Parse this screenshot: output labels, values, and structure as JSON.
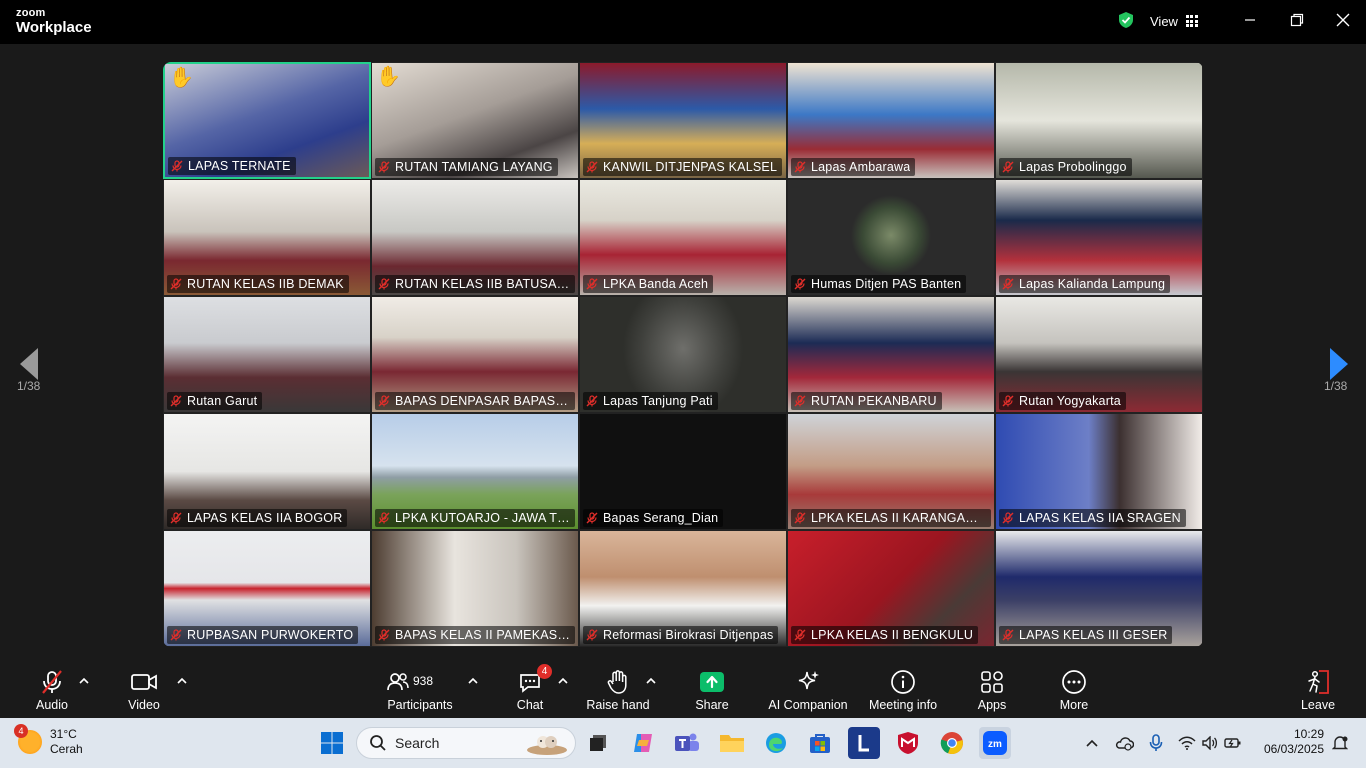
{
  "app": {
    "brand_top": "zoom",
    "brand_bottom": "Workplace",
    "view_label": "View"
  },
  "navigation": {
    "page_left": "1/38",
    "page_right": "1/38"
  },
  "tiles": [
    {
      "name": "LAPAS TERNATE",
      "hand": "✋",
      "bg": "linear-gradient(160deg,#c9ccd8 0%,#5565a6 45%,#2d3e8c 70%,#6b5a58 100%)"
    },
    {
      "name": "RUTAN TAMIANG LAYANG",
      "hand": "✋",
      "bg": "linear-gradient(160deg,#e3dcd3 0%,#a59d97 45%,#4b4545 75%,#c9c4bf 100%)"
    },
    {
      "name": "KANWIL DITJENPAS KALSEL",
      "hand": "",
      "bg": "linear-gradient(180deg,#8b1a2b 0%,#2c5aa8 40%,#d6ae57 70%,#7a6545 100%)"
    },
    {
      "name": "Lapas Ambarawa",
      "hand": "",
      "bg": "linear-gradient(180deg,#efe3d2 0%,#3c78c6 45%,#9a2c35 75%,#c7c2bd 100%)"
    },
    {
      "name": "Lapas Probolinggo",
      "hand": "",
      "bg": "linear-gradient(180deg,#b5b8aa 0%,#e5e5dc 50%,#8e8f86 80%,#55584f 100%)"
    },
    {
      "name": "RUTAN KELAS IIB DEMAK",
      "hand": "",
      "bg": "linear-gradient(180deg,#f2efe9 0%,#c9c3bb 45%,#7a2830 70%,#8a5a36 100%)"
    },
    {
      "name": "RUTAN KELAS IIB BATUSANGK...",
      "hand": "",
      "bg": "linear-gradient(180deg,#ecebe8 0%,#c8c8c4 45%,#6b2830 75%,#4d4a48 100%)"
    },
    {
      "name": "LPKA Banda Aceh",
      "hand": "",
      "bg": "linear-gradient(180deg,#eae9e1 0%,#d7d2c8 35%,#a82434 65%,#b8b2ab 100%)"
    },
    {
      "name": "Humas Ditjen PAS Banten",
      "hand": "",
      "bg": "radial-gradient(ellipse 40px 40px at 50% 48%,#7b8a68 0%,#3a4a35 70%,#2b2b2b 100%)"
    },
    {
      "name": "Lapas Kalianda Lampung",
      "hand": "",
      "bg": "linear-gradient(180deg,#e0ddd8 0%,#1a2a4a 35%,#b3313c 70%,#c6c9cf 100%)"
    },
    {
      "name": "Rutan Garut",
      "hand": "",
      "bg": "linear-gradient(180deg,#dddfe2 0%,#c9cbcf 40%,#5b2e33 70%,#3a3838 100%)"
    },
    {
      "name": "BAPAS DENPASAR BAPAS DEN...",
      "hand": "",
      "bg": "linear-gradient(180deg,#f0ece6 0%,#d8d2c8 35%,#7a2833 65%,#b39e86 100%)"
    },
    {
      "name": "Lapas Tanjung Pati",
      "hand": "",
      "bg": "radial-gradient(ellipse 60px 70px at 50% 45%,#6f6f6b 0%,#3f403c 70%,#2e2f2b 100%)"
    },
    {
      "name": "RUTAN PEKANBARU",
      "hand": "",
      "bg": "linear-gradient(180deg,#dcd8d0 0%,#1c2b55 40%,#a3283a 70%,#c7c0b7 100%)"
    },
    {
      "name": "Rutan Yogyakarta",
      "hand": "",
      "bg": "linear-gradient(180deg,#e9e8e4 0%,#c5c3be 40%,#3a3535 65%,#8d2a34 100%)"
    },
    {
      "name": "LAPAS KELAS IIA BOGOR",
      "hand": "",
      "bg": "linear-gradient(180deg,#f4f4f3 0%,#e6e6e4 50%,#5b4a44 75%,#2f2a28 100%)"
    },
    {
      "name": "LPKA KUTOARJO - JAWA TEN...",
      "hand": "",
      "bg": "linear-gradient(180deg,#b7cde8 0%,#d6e2ee 45%,#8f9ea5 55%,#7aa35a 70%,#5b8e2e 100%)"
    },
    {
      "name": "Bapas Serang_Dian",
      "hand": "",
      "bg": "#101010"
    },
    {
      "name": "LPKA KELAS II KARANGASEM",
      "hand": "",
      "bg": "linear-gradient(180deg,#cfd3d8 0%,#c39d86 45%,#a83a3a 70%,#9a7e72 100%)"
    },
    {
      "name": "LAPAS KELAS IIA SRAGEN",
      "hand": "",
      "bg": "linear-gradient(90deg,#2f4bb2 0%,#6d7fc7 45%,#3c3030 60%,#f1ece8 100%)"
    },
    {
      "name": "RUPBASAN PURWOKERTO",
      "hand": "",
      "bg": "linear-gradient(180deg,#ecedef 0%,#e5e6e9 45%,#c8222c 50%,#e0e1e3 60%,#5b6c9a 100%)"
    },
    {
      "name": "BAPAS KELAS II PAMEKASAN",
      "hand": "",
      "bg": "linear-gradient(90deg,#4d3d31 0%,#e8e4de 40%,#c9c4bd 70%,#6b5a4d 100%)"
    },
    {
      "name": "Reformasi Birokrasi Ditjenpas",
      "hand": "",
      "bg": "linear-gradient(180deg,#d9b59a 0%,#bf8f6f 40%,#f2f2f0 65%,#2b2b2b 100%)"
    },
    {
      "name": "LPKA KELAS II BENGKULU",
      "hand": "",
      "bg": "linear-gradient(135deg,#c81f2b 0%,#9b1520 50%,#4a3a36 75%,#7a2630 100%)"
    },
    {
      "name": "LAPAS KELAS III GESER",
      "hand": "",
      "bg": "linear-gradient(180deg,#e9eaec 0%,#1f2a6b 40%,#3b3f66 60%,#a9a29c 100%)"
    }
  ],
  "toolbar": {
    "audio": "Audio",
    "video": "Video",
    "participants": "Participants",
    "participants_count": "938",
    "chat": "Chat",
    "chat_badge": "4",
    "raise_hand": "Raise hand",
    "share": "Share",
    "ai_companion": "AI Companion",
    "meeting_info": "Meeting info",
    "apps": "Apps",
    "more": "More",
    "leave": "Leave"
  },
  "taskbar": {
    "weather_badge": "4",
    "temperature": "31°C",
    "condition": "Cerah",
    "search_placeholder": "Search",
    "time": "10:29",
    "date": "06/03/2025"
  },
  "colors": {
    "active_speaker": "#23d18b",
    "share_green": "#0cbd6a",
    "mic_off_red": "#e02e2a",
    "nav_arrow_blue": "#2d8cff"
  }
}
